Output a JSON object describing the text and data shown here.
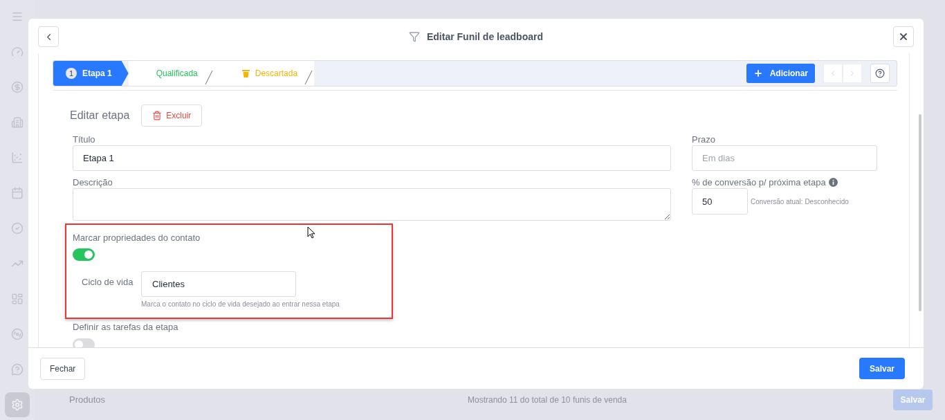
{
  "sidebar": {
    "items": [
      {
        "selected": false
      },
      {
        "selected": false
      },
      {
        "selected": false
      },
      {
        "selected": false
      },
      {
        "selected": false
      },
      {
        "selected": false
      },
      {
        "selected": false
      },
      {
        "selected": false
      },
      {
        "selected": false
      },
      {
        "selected": false
      },
      {
        "selected": false
      },
      {
        "selected": true
      }
    ]
  },
  "background": {
    "section_label": "Produtos",
    "footer_text": "Mostrando 11 do total de 10 funis de venda",
    "save_button": "Salvar"
  },
  "modal": {
    "title": "Editar Funil de leadboard",
    "steps": [
      {
        "kind": "numbered",
        "number": "1",
        "label": "Etapa 1",
        "selected": true
      },
      {
        "kind": "won",
        "label": "Qualificada",
        "selected": false
      },
      {
        "kind": "lost",
        "label": "Descartada",
        "selected": false
      }
    ],
    "add_button": "Adicionar",
    "section_title": "Editar etapa",
    "delete_button": "Excluir",
    "title_field": {
      "label": "Título",
      "value": "Etapa 1"
    },
    "description_field": {
      "label": "Descrição"
    },
    "deadline_field": {
      "label": "Prazo",
      "placeholder": "Em dias"
    },
    "conversion_field": {
      "label": "% de conversão p/ próxima etapa",
      "value": "50",
      "hint": "Conversão atual: Desconhecido"
    },
    "contact_properties": {
      "label": "Marcar propriedades do contato",
      "on": true,
      "lifecycle_label": "Ciclo de vida",
      "lifecycle_value": "Clientes",
      "hint": "Marca o contato no ciclo de vida desejado ao entrar nessa etapa"
    },
    "stage_tasks": {
      "label": "Definir as tarefas da etapa",
      "on": false
    },
    "close_button": "Fechar",
    "save_button": "Salvar"
  }
}
